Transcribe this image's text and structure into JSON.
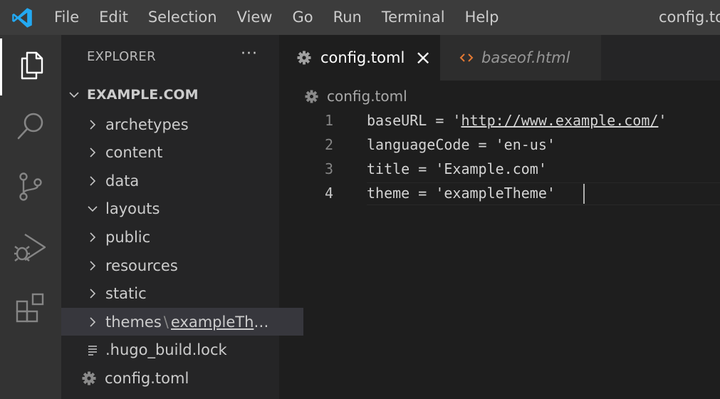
{
  "menu": [
    "File",
    "Edit",
    "Selection",
    "View",
    "Go",
    "Run",
    "Terminal",
    "Help"
  ],
  "window_title": "config.to",
  "activity_bar": [
    "explorer-icon",
    "search-icon",
    "source-control-icon",
    "run-debug-icon",
    "extensions-icon"
  ],
  "explorer": {
    "title": "EXPLORER",
    "more": "···",
    "root": "EXAMPLE.COM",
    "items": [
      {
        "label": "archetypes"
      },
      {
        "label": "content"
      },
      {
        "label": "data"
      },
      {
        "label": "layouts"
      },
      {
        "label": "public"
      },
      {
        "label": "resources"
      },
      {
        "label": "static"
      },
      {
        "label": "themes",
        "sep": "\\",
        "sub": "exampleThe..."
      },
      {
        "label": ".hugo_build.lock"
      },
      {
        "label": "config.toml"
      }
    ]
  },
  "tabs": [
    {
      "label": "config.toml",
      "close": "×",
      "icon": "gear-icon"
    },
    {
      "label": "baseof.html",
      "icon": "code-brackets-icon"
    }
  ],
  "breadcrumb": "config.toml",
  "editor": {
    "line_numbers": [
      "1",
      "2",
      "3",
      "4"
    ],
    "lines": [
      {
        "pre": "baseURL = '",
        "link": "http://www.example.com/",
        "post": "'"
      },
      {
        "text": "languageCode = 'en-us'"
      },
      {
        "text": "title = 'Example.com'"
      },
      {
        "text": "theme = 'exampleTheme'"
      }
    ]
  },
  "colors": {
    "accent_blue": "#23a9f2",
    "html_icon_orange": "#e37933",
    "editor_bg": "#1e1e1e",
    "sidebar_bg": "#252526"
  }
}
